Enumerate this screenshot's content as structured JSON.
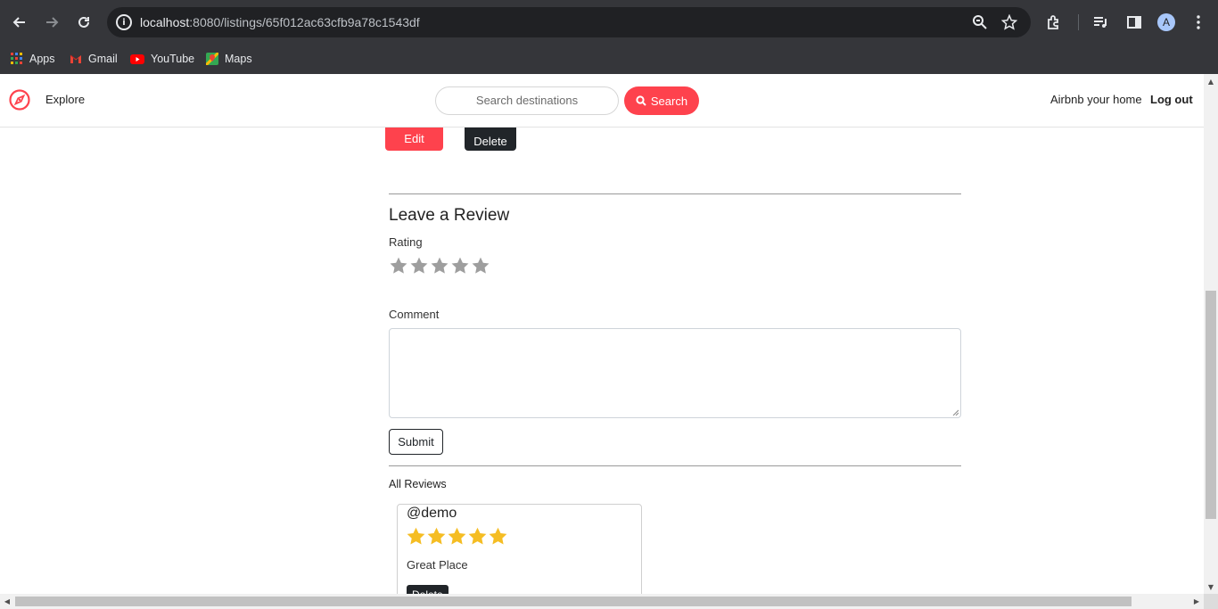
{
  "browser": {
    "url_host": "localhost",
    "url_path": ":8080/listings/65f012ac63cfb9a78c1543df",
    "avatar_letter": "A",
    "bookmarks": [
      {
        "label": "Apps",
        "icon": "apps-grid-icon"
      },
      {
        "label": "Gmail",
        "icon": "gmail-icon"
      },
      {
        "label": "YouTube",
        "icon": "youtube-icon"
      },
      {
        "label": "Maps",
        "icon": "maps-icon"
      }
    ]
  },
  "navbar": {
    "explore": "Explore",
    "search_placeholder": "Search destinations",
    "search_button": "Search",
    "airbnb_home": "Airbnb your home",
    "logout": "Log out",
    "brand_color": "#fe424d"
  },
  "listing_actions": {
    "edit": "Edit",
    "delete": "Delete"
  },
  "review_form": {
    "heading": "Leave a Review",
    "rating_label": "Rating",
    "rating_value": 0,
    "rating_max": 5,
    "comment_label": "Comment",
    "comment_value": "",
    "submit": "Submit"
  },
  "reviews": {
    "heading": "All Reviews",
    "items": [
      {
        "author": "@demo",
        "rating": 5,
        "comment": "Great Place",
        "delete_label": "Delete"
      }
    ]
  }
}
